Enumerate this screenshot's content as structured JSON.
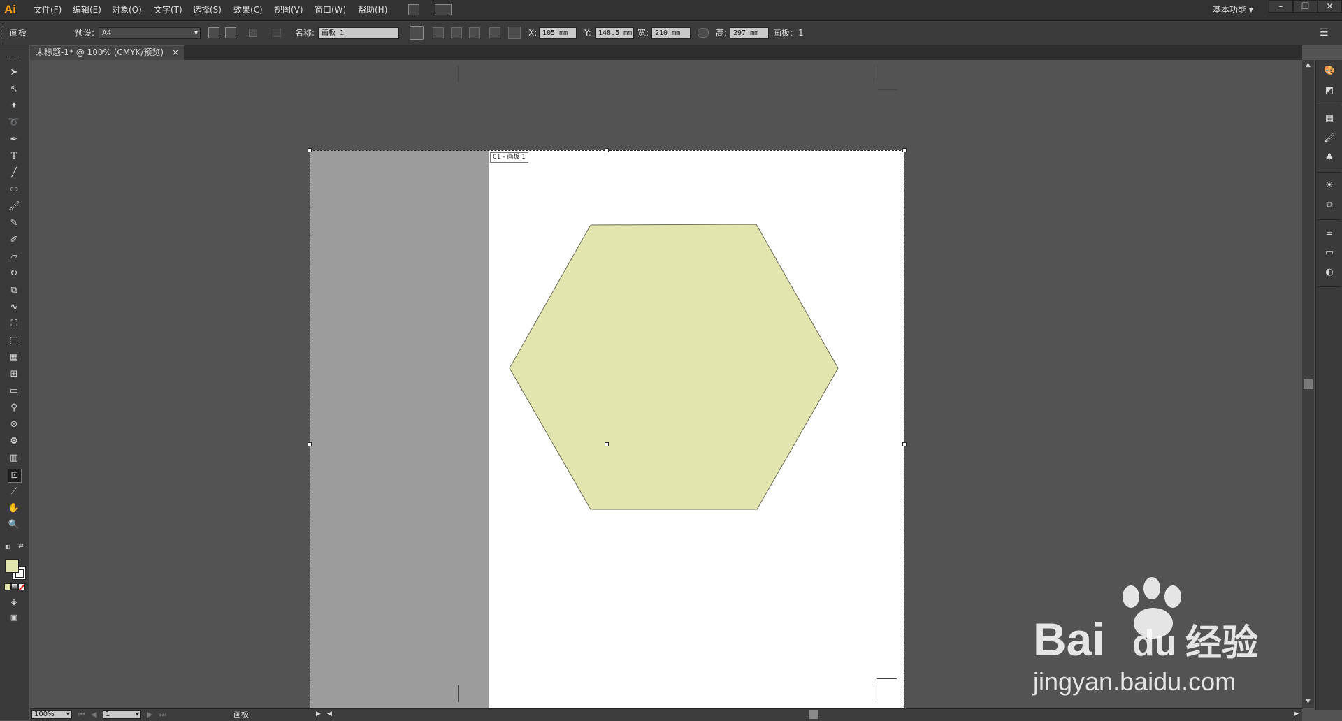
{
  "app": {
    "logo": "Ai"
  },
  "menu": {
    "items": [
      "文件(F)",
      "编辑(E)",
      "对象(O)",
      "文字(T)",
      "选择(S)",
      "效果(C)",
      "视图(V)",
      "窗口(W)",
      "帮助(H)"
    ],
    "workspace": "基本功能",
    "window_buttons": [
      "–",
      "❐",
      "✕"
    ]
  },
  "controlbar": {
    "mode_label": "画板",
    "preset_label": "预设:",
    "preset_value": "A4",
    "name_label": "名称:",
    "name_value": "画板 1",
    "x_label": "X:",
    "x_value": "105 mm",
    "y_label": "Y:",
    "y_value": "148.5 mm",
    "w_label": "宽:",
    "w_value": "210 mm",
    "h_label": "高:",
    "h_value": "297 mm",
    "artboards_label": "画板:",
    "artboards_value": "1"
  },
  "document": {
    "tab_title": "未标题-1* @ 100% (CMYK/预览)",
    "tab_close": "×",
    "artboard_label": "01 - 画板 1"
  },
  "colors": {
    "fill": "#e3e5ae",
    "stroke": "#222222",
    "hexagon_fill": "#e3e5ae",
    "hexagon_stroke": "#6b6b58",
    "artboard": "#ffffff",
    "pasteboard_gray": "#9c9c9c",
    "canvas": "#535353"
  },
  "statusbar": {
    "zoom": "100%",
    "artboard_nav_value": "1",
    "status_text": "画板"
  },
  "watermark": {
    "brand_left": "Bai",
    "brand_right": "du",
    "brand_cn": "经验",
    "url": "jingyan.baidu.com"
  }
}
